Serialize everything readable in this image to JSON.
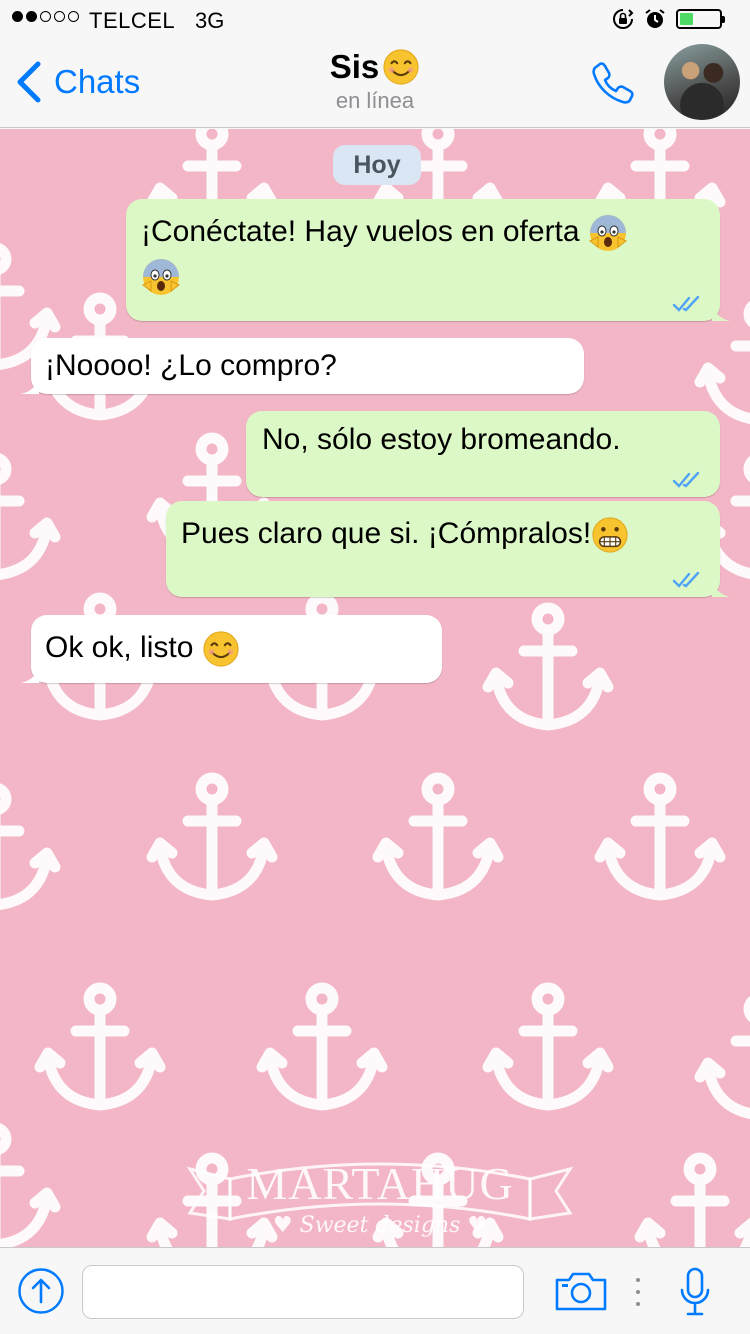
{
  "status_bar": {
    "signal_dots_filled": 2,
    "signal_dots_total": 5,
    "carrier": "TELCEL",
    "network": "3G",
    "battery_level": 0.35,
    "battery_color": "#4cd964"
  },
  "nav": {
    "back_label": "Chats",
    "contact_name": "Sis",
    "contact_name_emoji": "smiling-face-icon",
    "contact_status": "en línea",
    "call_icon": "phone-icon",
    "avatar": "contact-avatar",
    "accent_color": "#007aff"
  },
  "chat": {
    "background_color": "#f3b6c6",
    "background_pattern": "anchor-icon",
    "date_label": "Hoy",
    "watermark_title": "MARTAHUG",
    "watermark_subtitle": "♥ Sweet designs ♥",
    "messages": [
      {
        "direction": "out",
        "text": "¡Conéctate! Hay vuelos en oferta",
        "emoji": "screaming-face-icon",
        "emoji_count": 2,
        "status": "read"
      },
      {
        "direction": "in",
        "text": "¡Noooo! ¿Lo compro?"
      },
      {
        "direction": "out",
        "text": "No, sólo estoy bromeando.",
        "status": "read"
      },
      {
        "direction": "out",
        "text": "Pues claro que si. ¡Cómpralos!",
        "emoji": "grimacing-face-icon",
        "status": "read"
      },
      {
        "direction": "in",
        "text": "Ok ok, listo",
        "emoji": "smiling-face-icon"
      }
    ],
    "outgoing_bubble_color": "#dcf8c6",
    "incoming_bubble_color": "#ffffff",
    "read_tick_color": "#4fa3f7"
  },
  "input_bar": {
    "attach_icon": "upload-arrow-icon",
    "message_value": "",
    "camera_icon": "camera-icon",
    "mic_icon": "microphone-icon"
  }
}
